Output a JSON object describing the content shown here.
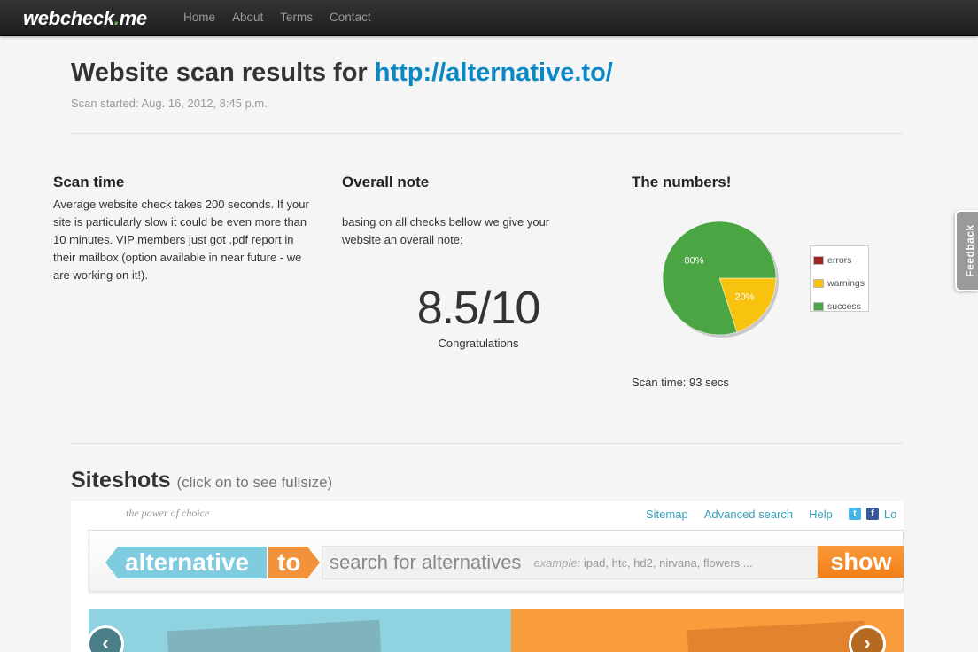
{
  "navbar": {
    "brand_main": "webcheck",
    "brand_dot": ".",
    "brand_tld": "me",
    "links": [
      "Home",
      "About",
      "Terms",
      "Contact"
    ]
  },
  "header": {
    "title_prefix": "Website scan results for",
    "url": "http://alternative.to/",
    "scan_started": "Scan started: Aug. 16, 2012, 8:45 p.m."
  },
  "scan_time": {
    "title": "Scan time",
    "text": "Average website check takes 200 seconds. If your site is particularly slow it could be even more than 10 minutes. VIP members just got .pdf report in their mailbox (option available in near future - we are working on it!)."
  },
  "overall_note": {
    "title": "Overall note",
    "text": "basing on all checks bellow we give your website an overall note:",
    "note": "8.5/10",
    "verdict": "Congratulations"
  },
  "numbers": {
    "title": "The numbers!",
    "scan_time_value": "Scan time: 93 secs"
  },
  "chart_data": {
    "type": "pie",
    "categories": [
      "errors",
      "warnings",
      "success"
    ],
    "values": [
      0,
      20,
      80
    ],
    "slice_labels": [
      "",
      "20%",
      "80%"
    ],
    "colors": [
      "#9b2623",
      "#f8c30e",
      "#4aa542"
    ],
    "legend_position": "right"
  },
  "siteshots": {
    "title": "Siteshots",
    "hint": "(click on to see fullsize)",
    "tagline": "the power of choice",
    "links": [
      "Sitemap",
      "Advanced search",
      "Help"
    ],
    "login_partial": "Lo",
    "logo_left": "alternative",
    "logo_right": "to",
    "search_placeholder": "search for alternatives",
    "example_label": "example:",
    "example_text": "ipad, htc, hd2, nirvana, flowers ...",
    "show_button": "show"
  },
  "feedback": {
    "label": "Feedback"
  }
}
